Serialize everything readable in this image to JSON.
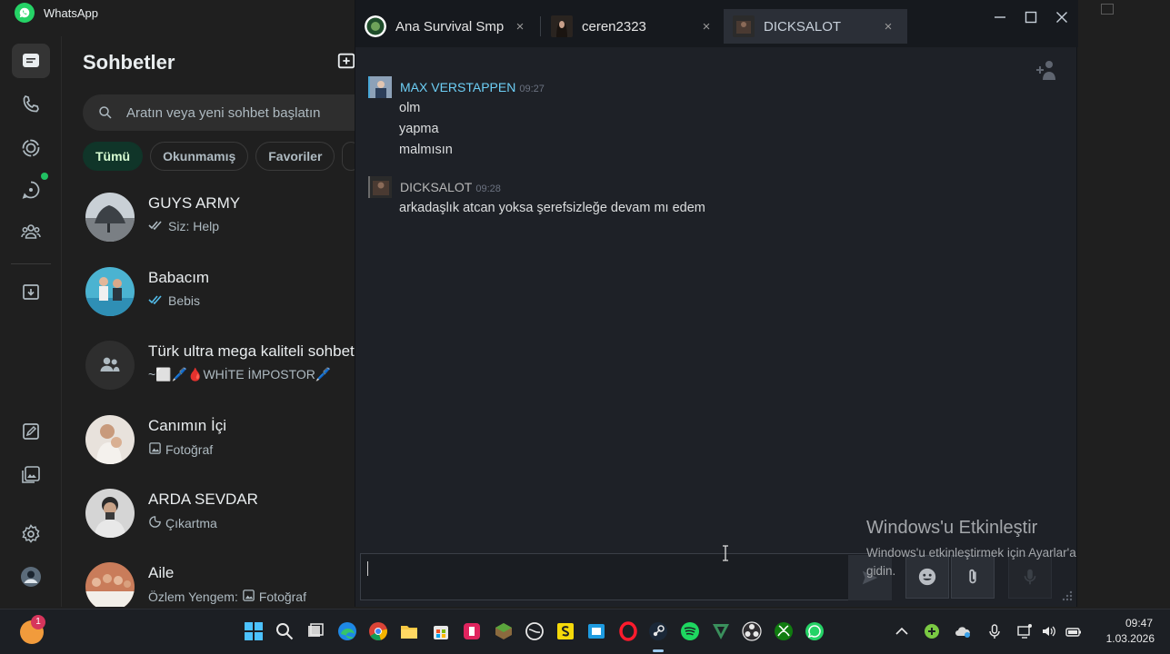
{
  "whatsapp": {
    "window_title": "WhatsApp",
    "list_title": "Sohbetler",
    "search_placeholder": "Aratın veya yeni sohbet başlatın",
    "chips": [
      "Tümü",
      "Okunmamış",
      "Favoriler"
    ],
    "chats": [
      {
        "name": "GUYS ARMY",
        "preview": "Siz: Help",
        "marker": "double-tick-grey-icon"
      },
      {
        "name": "Babacım",
        "preview": "Bebis",
        "marker": "double-tick-blue-icon"
      },
      {
        "name": "Türk ultra mega kaliteli sohbet",
        "preview": "~⬜🖊️🩸WHİTE İMPOSTOR🖊️",
        "marker": "none"
      },
      {
        "name": "Canımın İçi",
        "preview": "Fotoğraf",
        "marker": "photo-icon"
      },
      {
        "name": "ARDA SEVDAR",
        "preview": "Çıkartma",
        "marker": "sticker-icon"
      },
      {
        "name": "Aile",
        "preview_prefix": "Özlem Yengem:",
        "preview": "Fotoğraf",
        "marker": "photo-icon"
      }
    ],
    "accent": "#21c063"
  },
  "steam": {
    "tabs": [
      {
        "label": "Ana Survival Smp",
        "close": "×"
      },
      {
        "label": "ceren2323",
        "close": "×"
      },
      {
        "label": "DICKSALOT",
        "close": "×"
      }
    ],
    "messages": [
      {
        "sender": "MAX VERSTAPPEN",
        "time": "09:27",
        "sender_color": "#6dcff6",
        "lines": [
          "olm",
          "yapma",
          "malmısın"
        ]
      },
      {
        "sender": "DICKSALOT",
        "time": "09:28",
        "sender_color": "#b8b8b8",
        "lines": [
          "arkadaşlık atcan yoksa şerefsizleğe devam mı edem"
        ]
      }
    ]
  },
  "watermark": {
    "title": "Windows'u Etkinleştir",
    "line1": "Windows'u etkinleştirmek için Ayarlar'a",
    "line2": "gidin."
  },
  "taskbar": {
    "badge": "1",
    "time": "09:47",
    "date": "1.03.2026"
  }
}
